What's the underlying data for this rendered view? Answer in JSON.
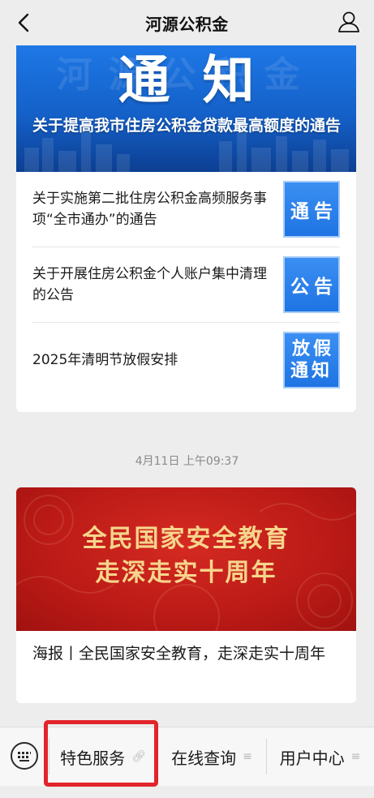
{
  "header": {
    "title": "河源公积金",
    "back_icon": "chevron-left-icon",
    "profile_icon": "user-icon"
  },
  "notice_card": {
    "hero": {
      "big_text": "通知",
      "subtitle": "关于提高我市住房公积金贷款最高额度的通告"
    },
    "items": [
      {
        "text": "关于实施第二批住房公积金高频服务事项“全市通办”的通告",
        "thumb": "通告"
      },
      {
        "text": "关于开展住房公积金个人账户集中清理的公告",
        "thumb": "公告"
      },
      {
        "text": "2025年清明节放假安排",
        "thumb": "放假\n通知"
      }
    ]
  },
  "timestamp": "4月11日 上午09:37",
  "article": {
    "cover_line_1": "全民国家安全教育",
    "cover_line_2": "走深走实十周年",
    "title": "海报丨全民国家安全教育，走深走实十周年"
  },
  "menu": {
    "keyboard_icon": "keyboard-icon",
    "items": [
      {
        "label": "特色服务",
        "mark": "link-icon"
      },
      {
        "label": "在线查询",
        "mark": "menu-lines-icon"
      },
      {
        "label": "用户中心",
        "mark": "menu-lines-icon"
      }
    ]
  },
  "colors": {
    "hero_blue": "#1e78e6",
    "thumb_blue": "#2b82ea",
    "cover_red": "#c21e19",
    "cover_gold": "#f6d58c",
    "highlight_red": "#e2242b",
    "background": "#ededed"
  }
}
